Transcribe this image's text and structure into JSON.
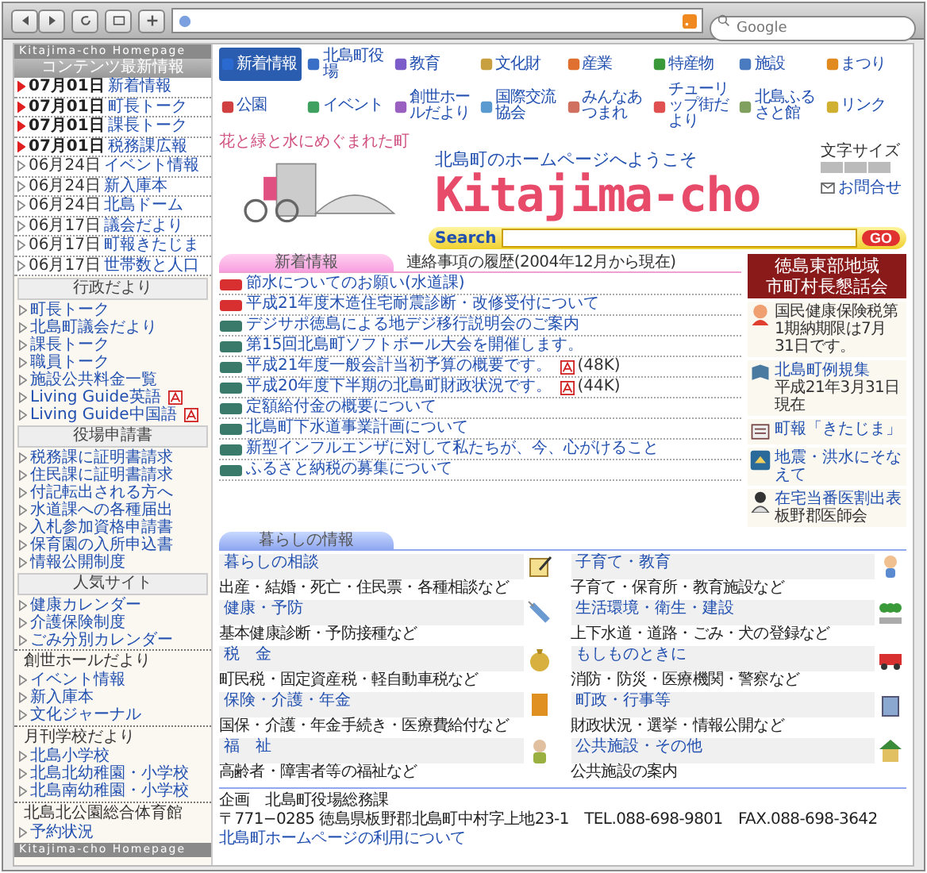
{
  "browser": {
    "search_placeholder": "Google"
  },
  "sidebar": {
    "top_strip": "Kitajima-cho Homepage",
    "latest_title": "コンテンツ最新情報",
    "latest": [
      {
        "date": "07月01日",
        "label": "新着情報",
        "new": true
      },
      {
        "date": "07月01日",
        "label": "町長トーク",
        "new": true
      },
      {
        "date": "07月01日",
        "label": "課長トーク",
        "new": true
      },
      {
        "date": "07月01日",
        "label": "税務課広報",
        "new": true
      },
      {
        "date": "06月24日",
        "label": "イベント情報",
        "new": false
      },
      {
        "date": "06月24日",
        "label": "新入庫本",
        "new": false
      },
      {
        "date": "06月24日",
        "label": "北島ドーム",
        "new": false
      },
      {
        "date": "06月17日",
        "label": "議会だより",
        "new": false
      },
      {
        "date": "06月17日",
        "label": "町報きたじま",
        "new": false
      },
      {
        "date": "06月17日",
        "label": "世帯数と人口",
        "new": false
      }
    ],
    "sections": [
      {
        "title": "行政だより",
        "links": [
          {
            "label": "町長トーク",
            "pdf": false
          },
          {
            "label": "北島町議会だより",
            "pdf": false
          },
          {
            "label": "課長トーク",
            "pdf": false
          },
          {
            "label": "職員トーク",
            "pdf": false
          },
          {
            "label": "施設公共料金一覧",
            "pdf": false
          },
          {
            "label": "Living Guide英語",
            "pdf": true
          },
          {
            "label": "Living Guide中国語",
            "pdf": true
          }
        ]
      },
      {
        "title": "役場申請書",
        "links": [
          {
            "label": "税務課に証明書請求",
            "pdf": false
          },
          {
            "label": "住民課に証明書請求",
            "pdf": false
          },
          {
            "label": "付記転出される方へ",
            "pdf": false
          },
          {
            "label": "水道課への各種届出",
            "pdf": false
          },
          {
            "label": "入札参加資格申請書",
            "pdf": false
          },
          {
            "label": "保育園の入所申込書",
            "pdf": false
          },
          {
            "label": "情報公開制度",
            "pdf": false
          }
        ]
      },
      {
        "title": "人気サイト",
        "links": [
          {
            "label": "健康カレンダー",
            "pdf": false
          },
          {
            "label": "介護保険制度",
            "pdf": false
          },
          {
            "label": "ごみ分別カレンダー",
            "pdf": false
          }
        ]
      }
    ],
    "groups": [
      {
        "title": "創世ホールだより",
        "links": [
          "イベント情報",
          "新入庫本",
          "文化ジャーナル"
        ]
      },
      {
        "title": "月刊学校だより",
        "links": [
          "北島小学校",
          "北島北幼稚園・小学校",
          "北島南幼稚園・小学校"
        ]
      },
      {
        "title": "北島北公園総合体育館",
        "links": [
          "予約状況"
        ]
      }
    ],
    "bottom_strip": "Kitajima-cho Homepage"
  },
  "nav": [
    {
      "label": "新着情報",
      "selected": true
    },
    {
      "label": "北島町役場",
      "selected": false
    },
    {
      "label": "教育",
      "selected": false
    },
    {
      "label": "文化財",
      "selected": false
    },
    {
      "label": "産業",
      "selected": false
    },
    {
      "label": "特産物",
      "selected": false
    },
    {
      "label": "施設",
      "selected": false
    },
    {
      "label": "まつり",
      "selected": false
    },
    {
      "label": "公園",
      "selected": false
    },
    {
      "label": "イベント",
      "selected": false
    },
    {
      "label": "創世ホールだより",
      "selected": false
    },
    {
      "label": "国際交流協会",
      "selected": false
    },
    {
      "label": "みんなあつまれ",
      "selected": false
    },
    {
      "label": "チューリップ街だより",
      "selected": false
    },
    {
      "label": "北島ふるさと館",
      "selected": false
    },
    {
      "label": "リンク",
      "selected": false
    }
  ],
  "header": {
    "tagline": "花と緑と水にめぐまれた町",
    "welcome": "北島町のホームページへようこそ",
    "logo": "Kitajima-cho",
    "font_size_label": "文字サイズ",
    "contact": "お問合せ",
    "search_label": "Search",
    "search_button": "GO"
  },
  "news": {
    "title": "新着情報",
    "history_link": "連絡事項の履歴(2004年12月から現在)",
    "items": [
      {
        "text": "節水についてのお願い(水道課)",
        "new": true
      },
      {
        "text": "平成21年度木造住宅耐震診断・改修受付について",
        "new": true
      },
      {
        "text": "デジサポ徳島による地デジ移行説明会のご案内",
        "new": false
      },
      {
        "text": "第15回北島町ソフトボール大会を開催します。",
        "new": false
      },
      {
        "text": "平成21年度一般会計当初予算の概要です。",
        "new": false,
        "pdf_size": "(48K)"
      },
      {
        "text": "平成20年度下半期の北島町財政状況です。",
        "new": false,
        "pdf_size": "(44K)"
      },
      {
        "text": "定額給付金の概要について",
        "new": false
      },
      {
        "text": "北島町下水道事業計画について",
        "new": false
      },
      {
        "text": "新型インフルエンザに対して私たちが、今、心がけること",
        "new": false
      },
      {
        "text": "ふるさと納税の募集について",
        "new": false
      }
    ]
  },
  "right": {
    "banner": [
      "徳島東部地域",
      "市町村長懇話会"
    ],
    "items": [
      {
        "kind": "person",
        "note": "国民健康保険税第1期納期限は7月31日です。"
      },
      {
        "kind": "book",
        "link": "北島町例規集",
        "note": "平成21年3月31日現在"
      },
      {
        "kind": "newspaper",
        "link": "町報「きたじま」"
      },
      {
        "kind": "hazard",
        "link": "地震・洪水にそなえて"
      },
      {
        "kind": "doctor",
        "link": "在宅当番医割出表",
        "note": "板野郡医師会"
      }
    ]
  },
  "living": {
    "title": "暮らしの情報",
    "items": [
      {
        "kind": "consult",
        "title": "暮らしの相談",
        "description": "出産・結婚・死亡・住民票・各種相談など"
      },
      {
        "kind": "child",
        "title": "子育て・教育",
        "description": "子育て・保育所・教育施設など"
      },
      {
        "kind": "health",
        "title": "健康・予防",
        "description": "基本健康診断・予防接種など"
      },
      {
        "kind": "environment",
        "title": "生活環境・衛生・建設",
        "description": "上下水道・道路・ごみ・犬の登録など"
      },
      {
        "kind": "tax",
        "title": "税　金",
        "description": "町民税・固定資産税・軽自動車税など"
      },
      {
        "kind": "emergency",
        "title": "もしものときに",
        "description": "消防・防災・医療機関・警察など"
      },
      {
        "kind": "insurance",
        "title": "保険・介護・年金",
        "description": "国保・介護・年金手続き・医療費給付など"
      },
      {
        "kind": "admin",
        "title": "町政・行事等",
        "description": "財政状況・選挙・情報公開など"
      },
      {
        "kind": "welfare",
        "title": "福　祉",
        "description": "高齢者・障害者等の福祉など"
      },
      {
        "kind": "facility",
        "title": "公共施設・その他",
        "description": "公共施設の案内"
      }
    ]
  },
  "footer": {
    "dept": "企画　北島町役場総務課",
    "address": "〒771−0285 徳島県板野郡北島町中村字上地23-1　TEL.088-698-9801　FAX.088-698-3642",
    "link": "北島町ホームページの利用について"
  }
}
